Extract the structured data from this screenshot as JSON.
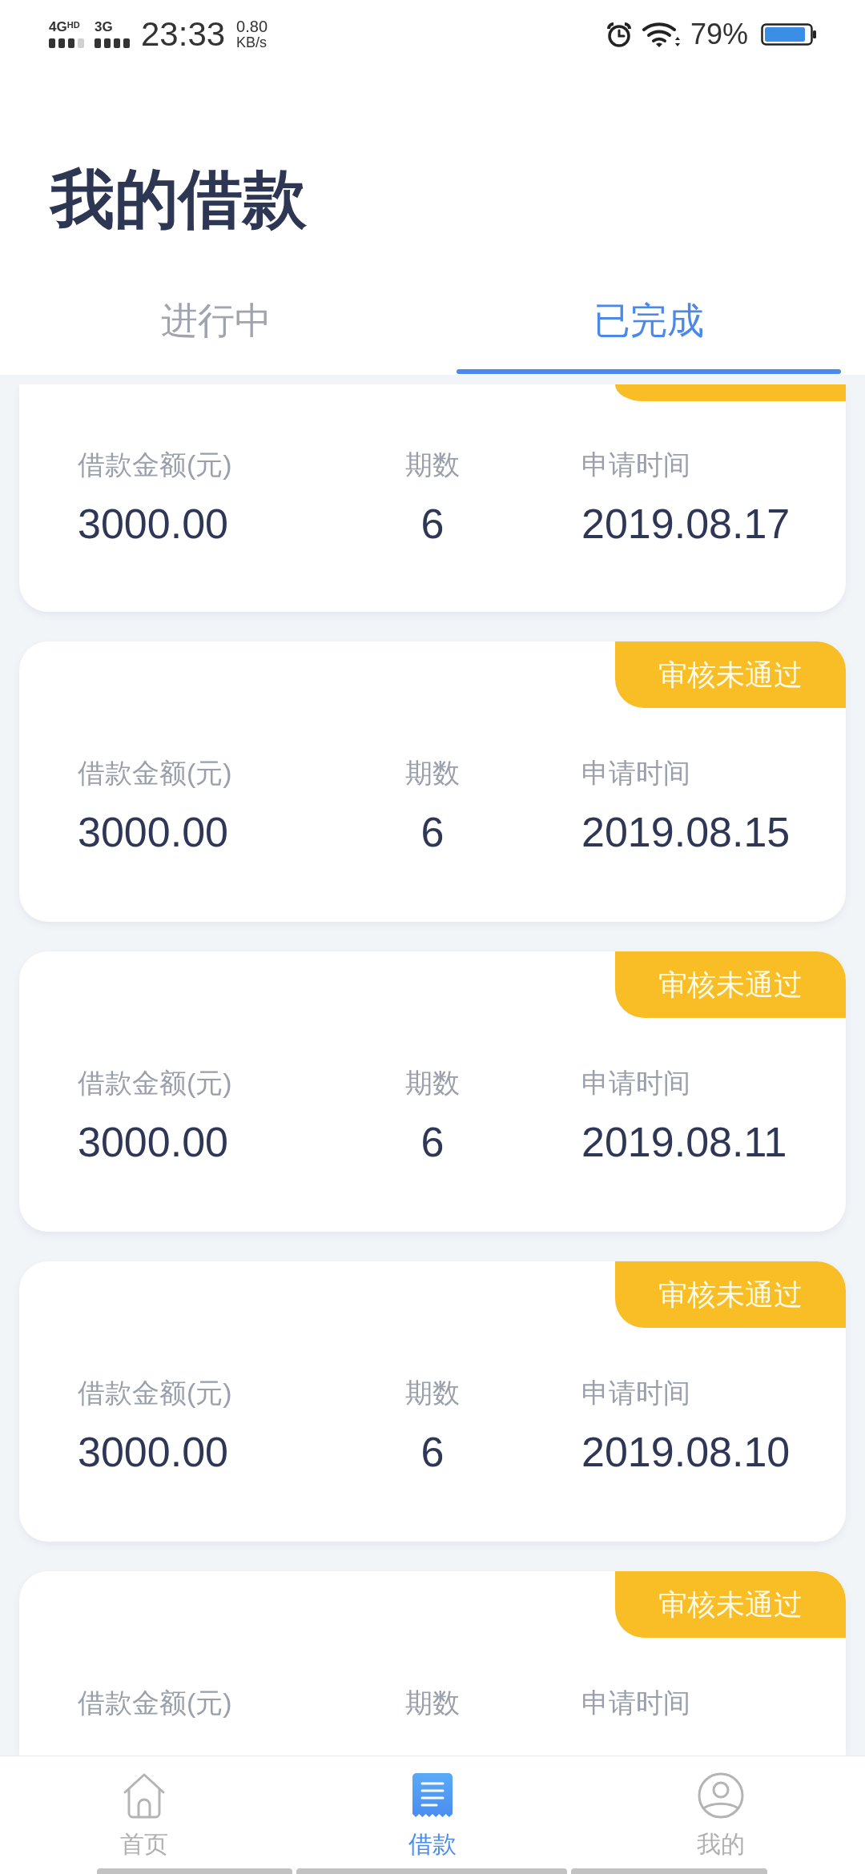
{
  "status_bar": {
    "network_1": "4G$^{HD}$",
    "network_2": "3G",
    "time": "23:33",
    "speed": "0.80",
    "speed_unit": "KB/s",
    "battery": "79%"
  },
  "page_title": "我的借款",
  "tabs": [
    {
      "label": "进行中",
      "selected": false
    },
    {
      "label": "已完成",
      "selected": true
    }
  ],
  "loans": [
    {
      "clipped_top": true,
      "clipped_bottom": false,
      "has_badge": true,
      "amount_label": "借款金额(元)",
      "amount": "3000.00",
      "term_label": "期数",
      "term": "6",
      "date_label": "申请时间",
      "date": "2019.08.17"
    },
    {
      "clipped_top": false,
      "clipped_bottom": false,
      "has_badge": true,
      "badge": "审核未通过",
      "amount_label": "借款金额(元)",
      "amount": "3000.00",
      "term_label": "期数",
      "term": "6",
      "date_label": "申请时间",
      "date": "2019.08.15"
    },
    {
      "clipped_top": false,
      "clipped_bottom": false,
      "has_badge": true,
      "badge": "审核未通过",
      "amount_label": "借款金额(元)",
      "amount": "3000.00",
      "term_label": "期数",
      "term": "6",
      "date_label": "申请时间",
      "date": "2019.08.11"
    },
    {
      "clipped_top": false,
      "clipped_bottom": false,
      "has_badge": true,
      "badge": "审核未通过",
      "amount_label": "借款金额(元)",
      "amount": "3000.00",
      "term_label": "期数",
      "term": "6",
      "date_label": "申请时间",
      "date": "2019.08.10"
    },
    {
      "clipped_top": false,
      "clipped_bottom": true,
      "has_badge": true,
      "badge": "审核未通过",
      "amount_label": "借款金额(元)",
      "term_label": "期数",
      "date_label": "申请时间"
    }
  ],
  "bottom_nav": [
    {
      "label": "首页",
      "selected": false
    },
    {
      "label": "借款",
      "selected": true
    },
    {
      "label": "我的",
      "selected": false
    }
  ]
}
